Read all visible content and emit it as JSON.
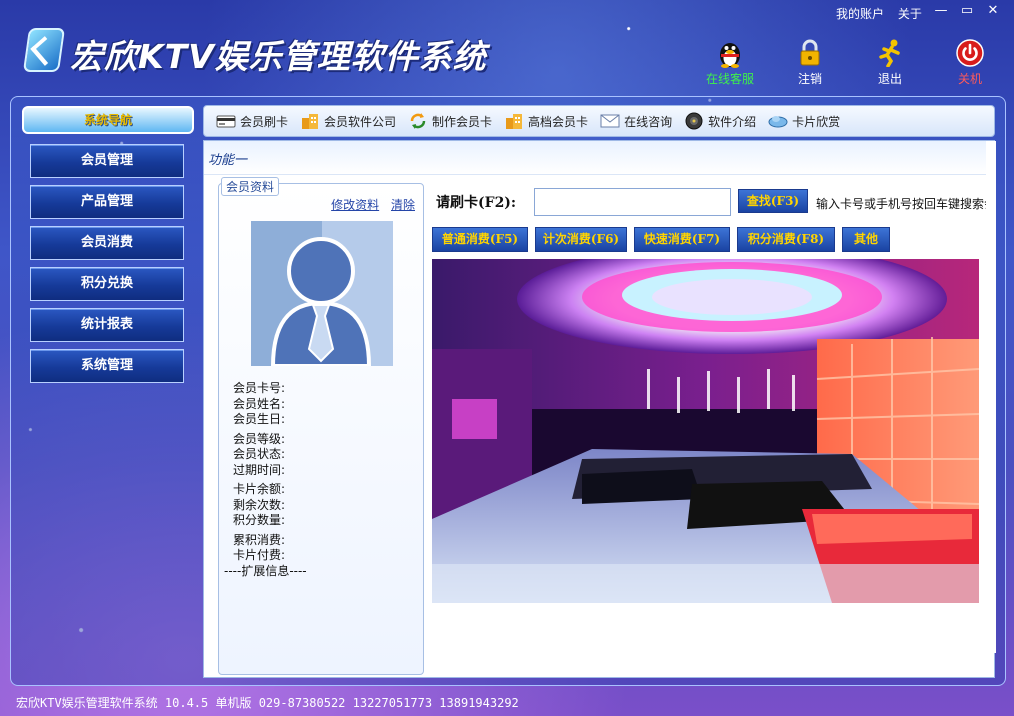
{
  "app": {
    "title": "宏欣KTV娱乐管理软件系统"
  },
  "top_links": {
    "account": "我的账户",
    "about": "关于"
  },
  "window_controls": {
    "minimize": "—",
    "restore": "▭",
    "close": "✕"
  },
  "top_icons": [
    {
      "label": "在线客服",
      "icon": "qq-penguin-icon"
    },
    {
      "label": "注销",
      "icon": "lock-icon"
    },
    {
      "label": "退出",
      "icon": "running-man-icon"
    },
    {
      "label": "关机",
      "icon": "power-icon"
    }
  ],
  "sidebar": {
    "header": "系统导航",
    "items": [
      {
        "label": "会员管理"
      },
      {
        "label": "产品管理"
      },
      {
        "label": "会员消费"
      },
      {
        "label": "积分兑换"
      },
      {
        "label": "统计报表"
      },
      {
        "label": "系统管理"
      }
    ]
  },
  "toolbar": {
    "items": [
      {
        "label": "会员刷卡",
        "icon": "card-reader-icon"
      },
      {
        "label": "会员软件公司",
        "icon": "building-icon"
      },
      {
        "label": "制作会员卡",
        "icon": "refresh-icon"
      },
      {
        "label": "高档会员卡",
        "icon": "building-icon"
      },
      {
        "label": "在线咨询",
        "icon": "mail-icon"
      },
      {
        "label": "软件介绍",
        "icon": "disc-icon"
      },
      {
        "label": "卡片欣赏",
        "icon": "cloud-icon"
      }
    ]
  },
  "main": {
    "section_title": "功能一",
    "member_panel": {
      "legend": "会员资料",
      "edit_link": "修改资料",
      "clear_link": "清除",
      "fields": {
        "card_no": "会员卡号:",
        "name": "会员姓名:",
        "birthday": "会员生日:",
        "level": "会员等级:",
        "status": "会员状态:",
        "expire": "过期时间:",
        "balance": "卡片余额:",
        "remaining": "剩余次数:",
        "points": "积分数量:",
        "total_spent": "累积消费:",
        "card_fee": "卡片付费:",
        "ext_info": "----扩展信息----"
      }
    },
    "swipe": {
      "label": "请刷卡(F2):",
      "value": "",
      "find_button": "查找(F3)",
      "hint": "输入卡号或手机号按回车键搜索会"
    },
    "actions": [
      {
        "label": "普通消费(F5)"
      },
      {
        "label": "计次消费(F6)"
      },
      {
        "label": "快速消费(F7)"
      },
      {
        "label": "积分消费(F8)"
      },
      {
        "label": "其他"
      }
    ]
  },
  "statusbar": {
    "text": "宏欣KTV娱乐管理软件系统 10.4.5 单机版 029-87380522 13227051773 13891943292"
  }
}
